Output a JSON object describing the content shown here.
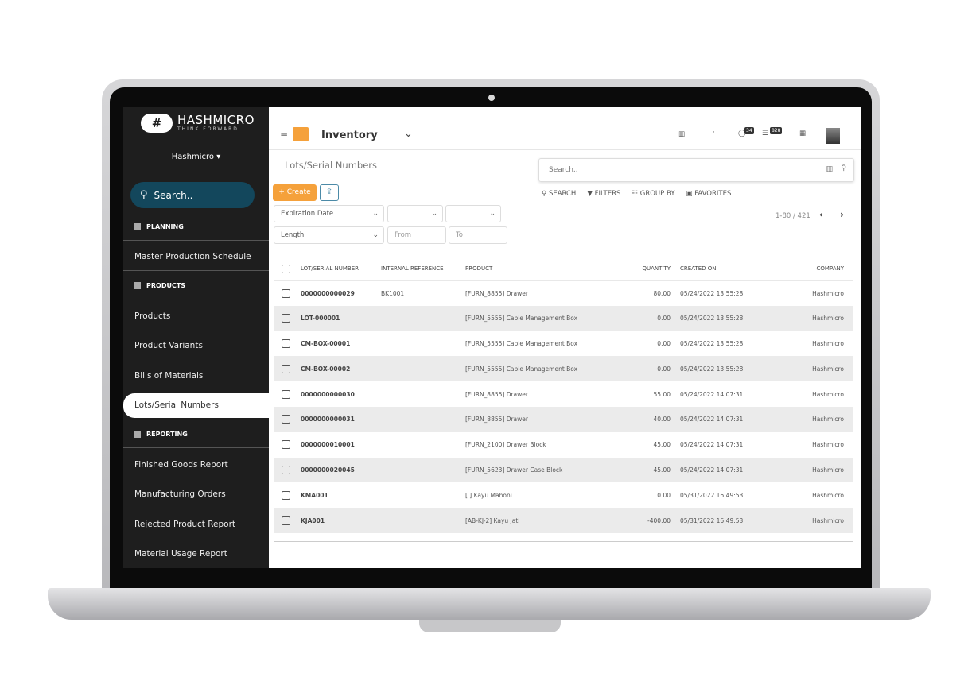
{
  "brand": {
    "name": "HASHMICRO",
    "tagline": "THINK FORWARD",
    "company": "Hashmicro"
  },
  "sidebar": {
    "search": "Search..",
    "sections": [
      {
        "title": "PLANNING",
        "items": [
          "Master Production Schedule"
        ]
      },
      {
        "title": "PRODUCTS",
        "items": [
          "Products",
          "Product Variants",
          "Bills of Materials",
          "Lots/Serial Numbers"
        ]
      },
      {
        "title": "REPORTING",
        "items": [
          "Finished Goods Report",
          "Manufacturing Orders",
          "Rejected Product Report",
          "Material Usage Report"
        ]
      }
    ],
    "active": "Lots/Serial Numbers"
  },
  "topbar": {
    "app": "Inventory",
    "activity_badge": "34",
    "message_badge": "828"
  },
  "page": {
    "title": "Lots/Serial Numbers",
    "create": "+ Create"
  },
  "filters": {
    "field1": "Expiration Date",
    "field2": "Length",
    "from": "From",
    "to": "To"
  },
  "search": {
    "placeholder": "Search..",
    "search": "SEARCH",
    "filters": "FILTERS",
    "group_by": "GROUP BY",
    "favorites": "FAVORITES"
  },
  "pager": "1-80 / 421",
  "table": {
    "headers": [
      "LOT/SERIAL NUMBER",
      "INTERNAL REFERENCE",
      "PRODUCT",
      "QUANTITY",
      "CREATED ON",
      "COMPANY"
    ],
    "rows": [
      [
        "0000000000029",
        "BK1001",
        "[FURN_8855] Drawer",
        "80.00",
        "05/24/2022 13:55:28",
        "Hashmicro"
      ],
      [
        "LOT-000001",
        "",
        "[FURN_5555] Cable Management Box",
        "0.00",
        "05/24/2022 13:55:28",
        "Hashmicro"
      ],
      [
        "CM-BOX-00001",
        "",
        "[FURN_5555] Cable Management Box",
        "0.00",
        "05/24/2022 13:55:28",
        "Hashmicro"
      ],
      [
        "CM-BOX-00002",
        "",
        "[FURN_5555] Cable Management Box",
        "0.00",
        "05/24/2022 13:55:28",
        "Hashmicro"
      ],
      [
        "0000000000030",
        "",
        "[FURN_8855] Drawer",
        "55.00",
        "05/24/2022 14:07:31",
        "Hashmicro"
      ],
      [
        "0000000000031",
        "",
        "[FURN_8855] Drawer",
        "40.00",
        "05/24/2022 14:07:31",
        "Hashmicro"
      ],
      [
        "0000000010001",
        "",
        "[FURN_2100] Drawer Block",
        "45.00",
        "05/24/2022 14:07:31",
        "Hashmicro"
      ],
      [
        "0000000020045",
        "",
        "[FURN_5623] Drawer Case Block",
        "45.00",
        "05/24/2022 14:07:31",
        "Hashmicro"
      ],
      [
        "KMA001",
        "",
        "[ ] Kayu Mahoni",
        "0.00",
        "05/31/2022 16:49:53",
        "Hashmicro"
      ],
      [
        "KJA001",
        "",
        "[AB-KJ-2] Kayu Jati",
        "-400.00",
        "05/31/2022 16:49:53",
        "Hashmicro"
      ]
    ]
  },
  "colors": {
    "sidebar": "#1e1e1e",
    "search_pill": "#13475c",
    "create_button": "#f5a13b",
    "row_alt": "#ebebeb"
  }
}
